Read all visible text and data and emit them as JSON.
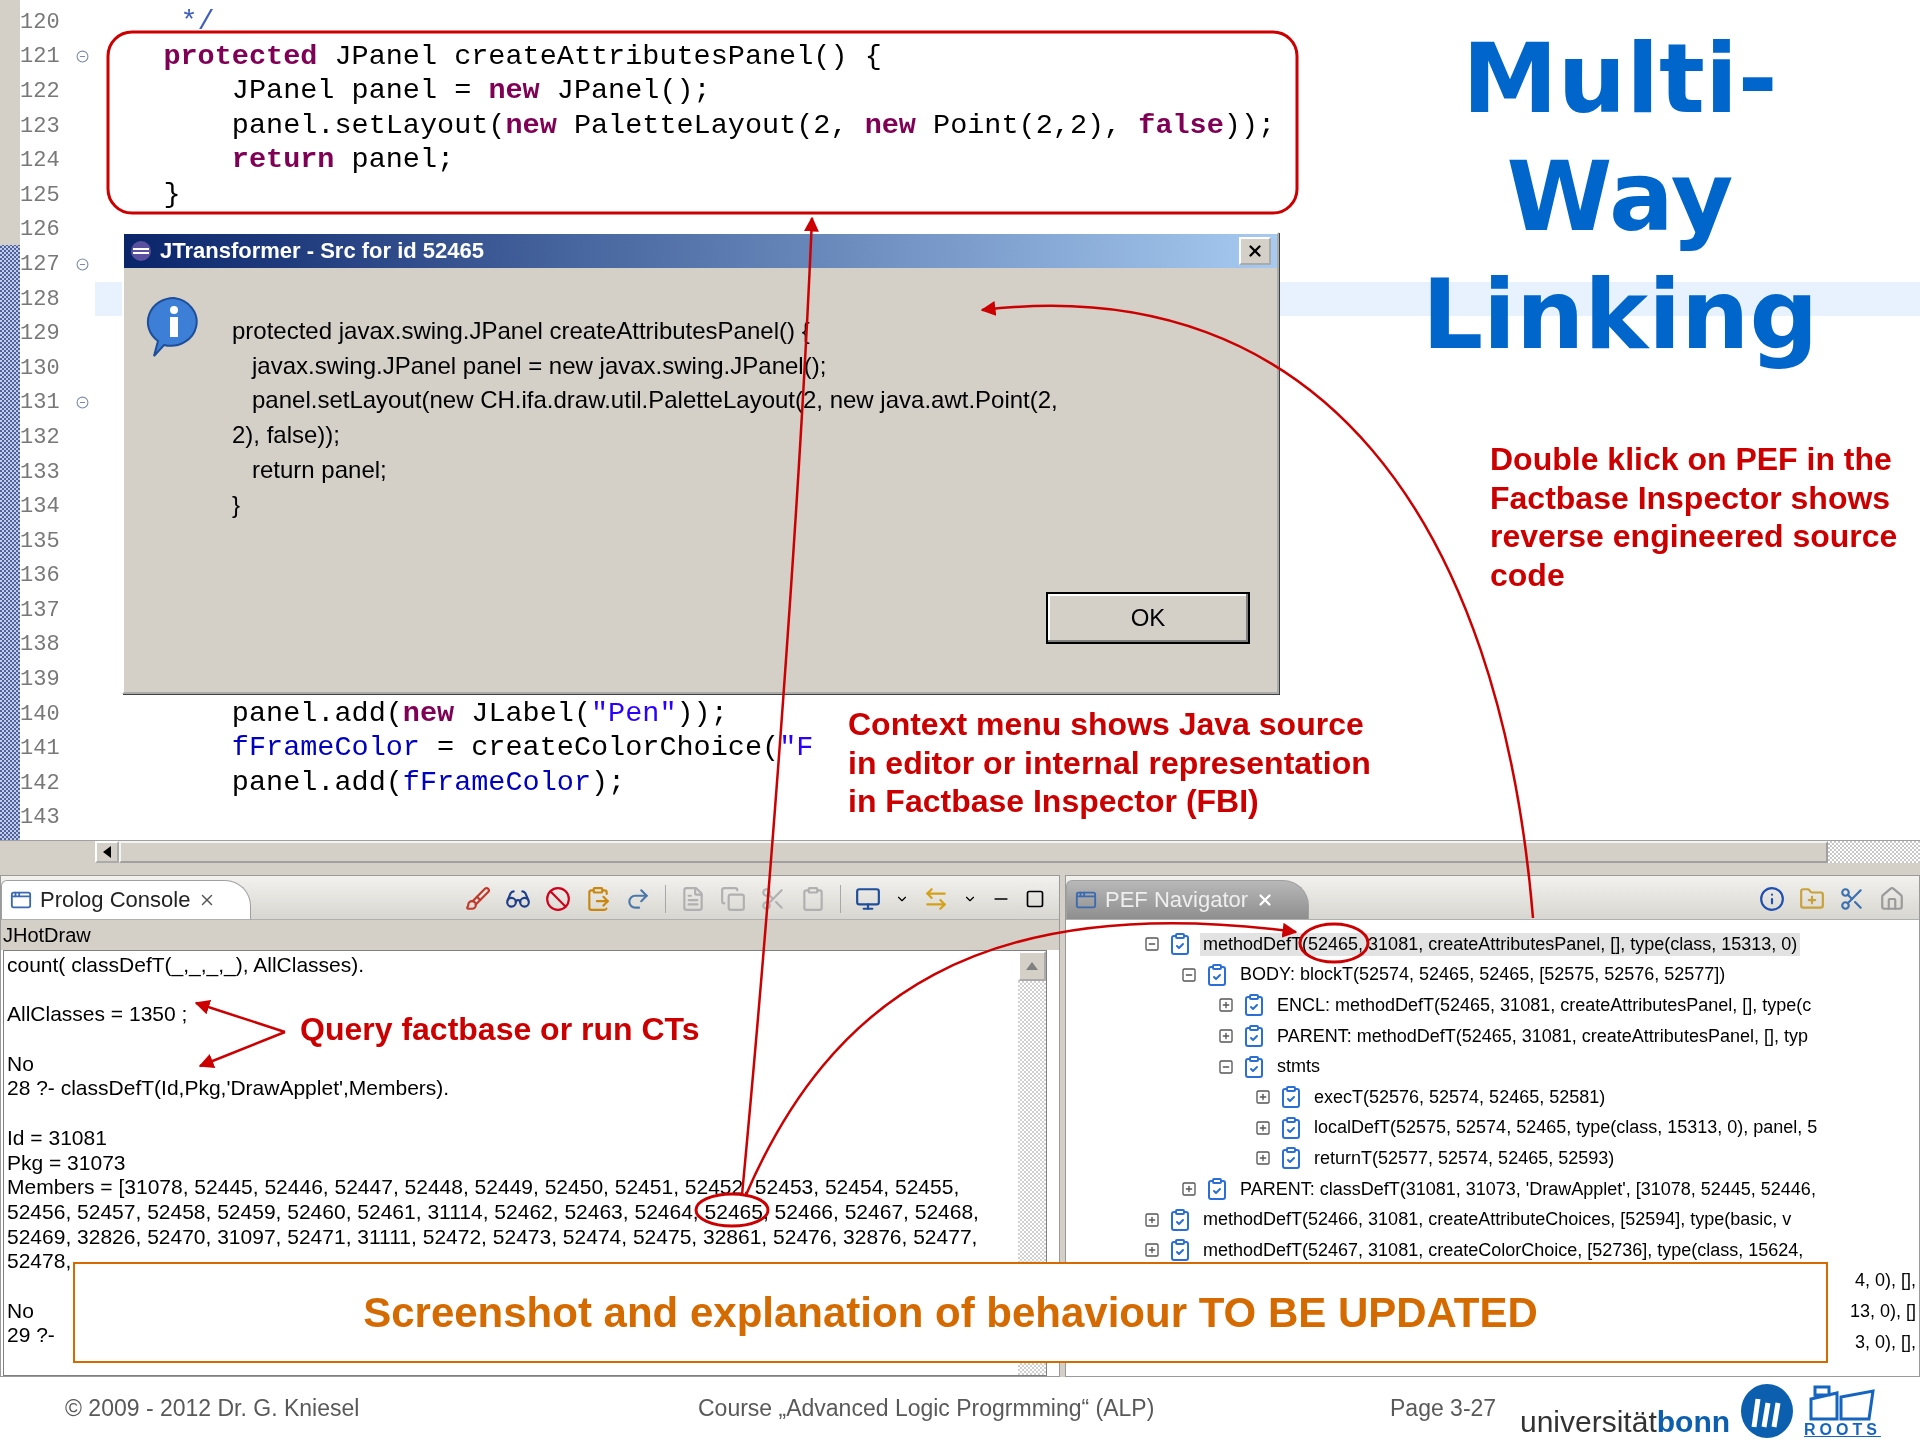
{
  "slide": {
    "title_lines": [
      "Multi-",
      "Way",
      "Linking"
    ]
  },
  "editor": {
    "lines": [
      {
        "number": "120",
        "fold": false,
        "current": false,
        "code": [
          {
            "kind": "comment",
            "text": "     */"
          }
        ]
      },
      {
        "number": "121",
        "fold": true,
        "current": false,
        "code": [
          {
            "kind": "keyword",
            "text": "    protected"
          },
          {
            "kind": "plain",
            "text": " JPanel createAttributesPanel() {"
          }
        ]
      },
      {
        "number": "122",
        "fold": false,
        "current": false,
        "code": [
          {
            "kind": "plain",
            "text": "        JPanel panel = "
          },
          {
            "kind": "keyword",
            "text": "new"
          },
          {
            "kind": "plain",
            "text": " JPanel();"
          }
        ]
      },
      {
        "number": "123",
        "fold": false,
        "current": false,
        "code": [
          {
            "kind": "plain",
            "text": "        panel.setLayout("
          },
          {
            "kind": "keyword",
            "text": "new"
          },
          {
            "kind": "plain",
            "text": " PaletteLayout(2, "
          },
          {
            "kind": "keyword",
            "text": "new"
          },
          {
            "kind": "plain",
            "text": " Point(2,2), "
          },
          {
            "kind": "keyword",
            "text": "false"
          },
          {
            "kind": "plain",
            "text": "));"
          }
        ]
      },
      {
        "number": "124",
        "fold": false,
        "current": false,
        "code": [
          {
            "kind": "keyword",
            "text": "        return"
          },
          {
            "kind": "plain",
            "text": " panel;"
          }
        ]
      },
      {
        "number": "125",
        "fold": false,
        "current": false,
        "code": [
          {
            "kind": "plain",
            "text": "    }"
          }
        ]
      },
      {
        "number": "126",
        "fold": false,
        "current": false
      },
      {
        "number": "127",
        "fold": true,
        "current": false
      },
      {
        "number": "128",
        "fold": false,
        "current": true
      },
      {
        "number": "129",
        "fold": false,
        "current": false
      },
      {
        "number": "130",
        "fold": false,
        "current": false
      },
      {
        "number": "131",
        "fold": true,
        "current": false
      },
      {
        "number": "132",
        "fold": false,
        "current": false
      },
      {
        "number": "133",
        "fold": false,
        "current": false
      },
      {
        "number": "134",
        "fold": false,
        "current": false
      },
      {
        "number": "135",
        "fold": false,
        "current": false
      },
      {
        "number": "136",
        "fold": false,
        "current": false
      },
      {
        "number": "137",
        "fold": false,
        "current": false
      },
      {
        "number": "138",
        "fold": false,
        "current": false
      },
      {
        "number": "139",
        "fold": false,
        "current": false
      },
      {
        "number": "140",
        "fold": false,
        "current": false,
        "code": [
          {
            "kind": "plain",
            "text": "        panel.add("
          },
          {
            "kind": "keyword",
            "text": "new"
          },
          {
            "kind": "plain",
            "text": " JLabel("
          },
          {
            "kind": "string",
            "text": "\"Pen\""
          },
          {
            "kind": "plain",
            "text": "));"
          }
        ]
      },
      {
        "number": "141",
        "fold": false,
        "current": false,
        "code": [
          {
            "kind": "field",
            "text": "        fFrameColor"
          },
          {
            "kind": "plain",
            "text": " = createColorChoice("
          },
          {
            "kind": "string",
            "text": "\"F"
          }
        ]
      },
      {
        "number": "142",
        "fold": false,
        "current": false,
        "code": [
          {
            "kind": "plain",
            "text": "        panel.add("
          },
          {
            "kind": "field",
            "text": "fFrameColor"
          },
          {
            "kind": "plain",
            "text": ");"
          }
        ]
      },
      {
        "number": "143",
        "fold": false,
        "current": false
      }
    ]
  },
  "dialog": {
    "title": "JTransformer - Src for id 52465",
    "message_lines": [
      "protected javax.swing.JPanel createAttributesPanel() {",
      "   javax.swing.JPanel panel = new javax.swing.JPanel();",
      "   panel.setLayout(new CH.ifa.draw.util.PaletteLayout(2, new java.awt.Point(2,",
      "2), false));",
      "   return panel;",
      "}"
    ],
    "button": "OK"
  },
  "console": {
    "tab": {
      "label": "Prolog Console",
      "selected": true
    },
    "project": "JHotDraw",
    "lines": [
      {
        "kind": "text",
        "text": "count( classDefT(_,_,_,_), AllClasses)."
      },
      {
        "kind": "blank"
      },
      {
        "kind": "text",
        "text": "AllClasses = 1350 ;"
      },
      {
        "kind": "blank"
      },
      {
        "kind": "text",
        "text": "No"
      },
      {
        "kind": "text",
        "text": "28 ?- classDefT(Id,Pkg,'DrawApplet',Members)."
      },
      {
        "kind": "blank"
      },
      {
        "kind": "text",
        "text": "Id = 31081"
      },
      {
        "kind": "text",
        "text": "Pkg = 31073"
      },
      {
        "kind": "text",
        "text": "Members = [31078, 52445, 52446, 52447, 52448, 52449, 52450, 52451, 52452, 52453, 52454, 52455,"
      },
      {
        "kind": "text",
        "text": "52456, 52457, 52458, 52459, 52460, 52461, 31114, 52462, 52463, 52464, 52465, 52466, 52467, 52468,"
      },
      {
        "kind": "text",
        "text": "52469, 32826, 52470, 31097, 52471, 31111, 52472, 52473, 52474, 52475, 32861, 52476, 32876, 52477,"
      },
      {
        "kind": "text",
        "text": "52478,"
      },
      {
        "kind": "blank"
      },
      {
        "kind": "text",
        "text": "No"
      },
      {
        "kind": "text",
        "text": "29 ?-"
      }
    ]
  },
  "navigator": {
    "tab": {
      "label": "PEF Navigator",
      "selected": false
    },
    "tree": [
      {
        "text": "methodDefT(52465, 31081, createAttributesPanel, [], type(class, 15313, 0)",
        "expanded": true,
        "selected": true,
        "children": [
          {
            "text": "BODY: blockT(52574, 52465, 52465, [52575, 52576, 52577])",
            "expanded": true,
            "selected": false,
            "children": [
              {
                "text": "ENCL: methodDefT(52465, 31081, createAttributesPanel, [], type(c",
                "expanded": false,
                "selected": false
              },
              {
                "text": "PARENT: methodDefT(52465, 31081, createAttributesPanel, [], typ",
                "expanded": false,
                "selected": false
              },
              {
                "text": "stmts",
                "expanded": true,
                "selected": false,
                "children": [
                  {
                    "text": "execT(52576, 52574, 52465, 52581)",
                    "expanded": false,
                    "selected": false
                  },
                  {
                    "text": "localDefT(52575, 52574, 52465, type(class, 15313, 0), panel, 5",
                    "expanded": false,
                    "selected": false
                  },
                  {
                    "text": "returnT(52577, 52574, 52465, 52593)",
                    "expanded": false,
                    "selected": false
                  }
                ]
              }
            ]
          },
          {
            "text": "PARENT: classDefT(31081, 31073, 'DrawApplet', [31078, 52445, 52446,",
            "expanded": false,
            "selected": false
          }
        ]
      },
      {
        "text": "methodDefT(52466, 31081, createAttributeChoices, [52594], type(basic, v",
        "expanded": false,
        "selected": false
      },
      {
        "text": "methodDefT(52467, 31081, createColorChoice, [52736], type(class, 15624,",
        "expanded": false,
        "selected": false
      }
    ],
    "covered_row_tails": [
      "4, 0), [],",
      "13, 0), []",
      "3, 0), [],"
    ]
  },
  "annotations": {
    "query": "Query factbase or run CTs",
    "context": "Context menu shows Java source in editor or internal representation in Factbase Inspector (FBI)",
    "double_click": "Double klick on PEF in the Factbase Inspector shows reverse engineered source code"
  },
  "banner": "Screenshot and explanation of behaviour TO BE UPDATED",
  "footer": {
    "copyright": "© 2009 - 2012 Dr. G. Kniesel",
    "course": "Course „Advanced Logic Progrmming“ (ALP)",
    "page": "Page 3-27",
    "wordmark": "universität**bonn**",
    "group": "ROOTS"
  }
}
